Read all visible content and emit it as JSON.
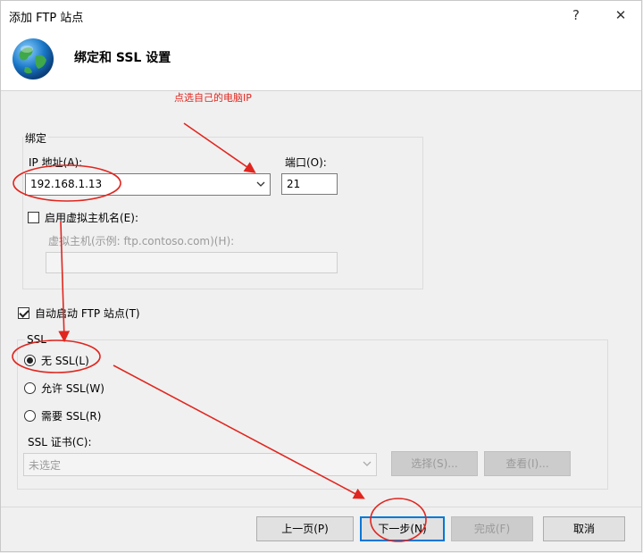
{
  "window": {
    "title": "添加 FTP 站点",
    "help_glyph": "?",
    "close_glyph": "✕"
  },
  "header": {
    "title": "绑定和 SSL 设置"
  },
  "annotation": {
    "note": "点选自己的电脑IP",
    "color": "#e0261f"
  },
  "binding": {
    "group_label": "绑定",
    "ip_label": "IP 地址(A):",
    "ip_value": "192.168.1.13",
    "port_label": "端口(O):",
    "port_value": "21",
    "vhost_checkbox_label": "启用虚拟主机名(E):",
    "vhost_checked": false,
    "vhost_field_label": "虚拟主机(示例: ftp.contoso.com)(H):",
    "vhost_value": ""
  },
  "autostart": {
    "label": "自动启动 FTP 站点(T)",
    "checked": true
  },
  "ssl": {
    "group_label": "SSL",
    "options": [
      {
        "label": "无 SSL(L)",
        "selected": true
      },
      {
        "label": "允许 SSL(W)",
        "selected": false
      },
      {
        "label": "需要 SSL(R)",
        "selected": false
      }
    ],
    "cert_label": "SSL 证书(C):",
    "cert_value": "未选定",
    "select_button": "选择(S)...",
    "view_button": "查看(I)..."
  },
  "footer": {
    "prev": "上一页(P)",
    "next": "下一步(N)",
    "finish": "完成(F)",
    "cancel": "取消"
  },
  "colors": {
    "accent": "#0078d7",
    "annotation": "#e0261f"
  }
}
